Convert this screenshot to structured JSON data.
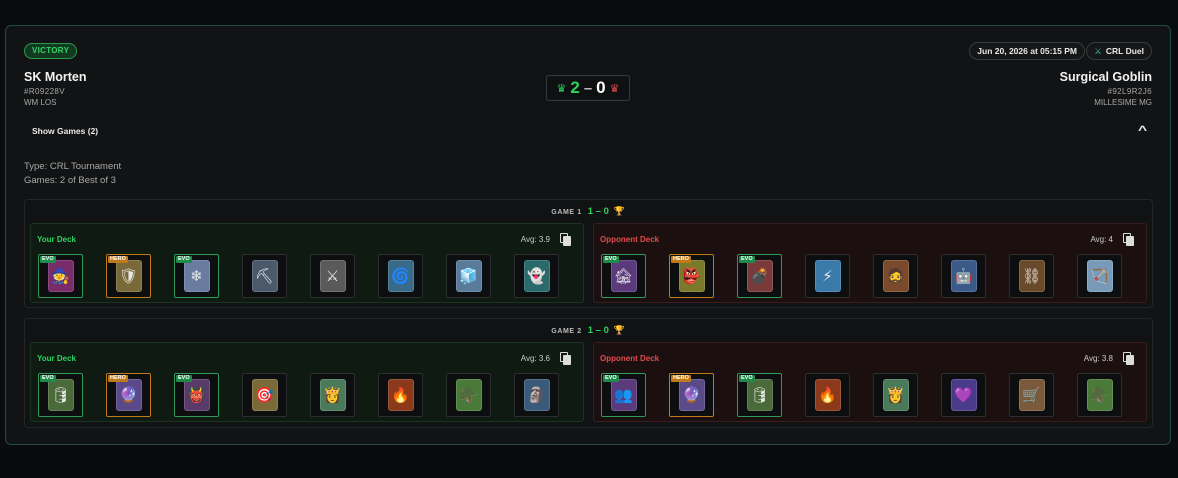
{
  "result_badge": "VICTORY",
  "date": "Jun 20, 2026 at 05:15 PM",
  "mode": {
    "icon": "crossed-swords-icon",
    "label": "CRL Duel"
  },
  "player": {
    "name": "SK Morten",
    "tag": "#R09228V",
    "clan": "WM LOS"
  },
  "opponent": {
    "name": "Surgical Goblin",
    "tag": "#92L9R2J6",
    "clan": "MILLESIME MG"
  },
  "score": {
    "player": "2",
    "separator": "–",
    "opponent": "0"
  },
  "show_games": "Show Games (2)",
  "type_line": "Type: CRL Tournament",
  "games_line": "Games: 2 of Best of 3",
  "colors": {
    "win": "#2fd35f",
    "loss": "#e24b4b",
    "accent": "#1f4a48"
  },
  "games": [
    {
      "title": "GAME 1",
      "score": "1 – 0",
      "your_deck": {
        "label": "Your Deck",
        "avg": "Avg: 3.9",
        "cards": [
          {
            "badge": "EVO",
            "icon": "witch-card",
            "glyph": "🧙",
            "color": "#7a2b6a"
          },
          {
            "badge": "HERO",
            "icon": "hero-knight-card",
            "glyph": "🛡",
            "color": "#7a6a3a"
          },
          {
            "badge": "EVO",
            "icon": "ice-spirit-card",
            "glyph": "❄",
            "color": "#6a7aa0"
          },
          {
            "badge": "",
            "icon": "miner-card",
            "glyph": "⛏",
            "color": "#4a5a6a"
          },
          {
            "badge": "",
            "icon": "mega-knight-card",
            "glyph": "⚔",
            "color": "#5a5a5a"
          },
          {
            "badge": "",
            "icon": "tornado-card",
            "glyph": "🌀",
            "color": "#3a6a8a"
          },
          {
            "badge": "",
            "icon": "ice-wizard-card",
            "glyph": "🧊",
            "color": "#5a7a9a"
          },
          {
            "badge": "",
            "icon": "spirit-card",
            "glyph": "👻",
            "color": "#2a6a6a"
          }
        ]
      },
      "opp_deck": {
        "label": "Opponent Deck",
        "avg": "Avg: 4",
        "cards": [
          {
            "badge": "EVO",
            "icon": "goblin-hut-card",
            "glyph": "🏚",
            "color": "#5a3a7a"
          },
          {
            "badge": "HERO",
            "icon": "hero-goblin-card",
            "glyph": "👺",
            "color": "#7a7a2a"
          },
          {
            "badge": "EVO",
            "icon": "bomb-tower-card",
            "glyph": "💣",
            "color": "#7a3a3a"
          },
          {
            "badge": "",
            "icon": "zap-card",
            "glyph": "⚡",
            "color": "#3a7aaa"
          },
          {
            "badge": "",
            "icon": "giant-card",
            "glyph": "🧔",
            "color": "#7a4a2a"
          },
          {
            "badge": "",
            "icon": "electro-giant-card",
            "glyph": "🤖",
            "color": "#3a5a8a"
          },
          {
            "badge": "",
            "icon": "goblin-drill-card",
            "glyph": "⛓",
            "color": "#6a4a2a"
          },
          {
            "badge": "",
            "icon": "arrows-card",
            "glyph": "🏹",
            "color": "#7a9aba"
          }
        ]
      }
    },
    {
      "title": "GAME 2",
      "score": "1 – 0",
      "your_deck": {
        "label": "Your Deck",
        "avg": "Avg: 3.6",
        "cards": [
          {
            "badge": "EVO",
            "icon": "goblin-barrel-card",
            "glyph": "🛢",
            "color": "#4a6a3a"
          },
          {
            "badge": "HERO",
            "icon": "hero-wizard-card",
            "glyph": "🔮",
            "color": "#5a4a8a"
          },
          {
            "badge": "EVO",
            "icon": "goblin-giant-card",
            "glyph": "👹",
            "color": "#5a3a6a"
          },
          {
            "badge": "",
            "icon": "cannon-card",
            "glyph": "🎯",
            "color": "#7a6a3a"
          },
          {
            "badge": "",
            "icon": "princess-card",
            "glyph": "👸",
            "color": "#4a7a5a"
          },
          {
            "badge": "",
            "icon": "fireball-card",
            "glyph": "🔥",
            "color": "#8a3a1a"
          },
          {
            "badge": "",
            "icon": "goblins-card",
            "glyph": "🪖",
            "color": "#4a7a3a"
          },
          {
            "badge": "",
            "icon": "ice-golem-card",
            "glyph": "🗿",
            "color": "#3a5a7a"
          }
        ]
      },
      "opp_deck": {
        "label": "Opponent Deck",
        "avg": "Avg: 3.8",
        "cards": [
          {
            "badge": "EVO",
            "icon": "goblin-gang-card",
            "glyph": "👥",
            "color": "#5a3a7a"
          },
          {
            "badge": "HERO",
            "icon": "hero-wizard-card",
            "glyph": "🔮",
            "color": "#5a4a8a"
          },
          {
            "badge": "EVO",
            "icon": "goblin-barrel-card",
            "glyph": "🛢",
            "color": "#4a6a3a"
          },
          {
            "badge": "",
            "icon": "fireball-card",
            "glyph": "🔥",
            "color": "#8a3a1a"
          },
          {
            "badge": "",
            "icon": "princess-card",
            "glyph": "👸",
            "color": "#4a7a5a"
          },
          {
            "badge": "",
            "icon": "electro-spirit-card",
            "glyph": "💜",
            "color": "#4a3a8a"
          },
          {
            "badge": "",
            "icon": "cannon-cart-card",
            "glyph": "🛒",
            "color": "#7a5a3a"
          },
          {
            "badge": "",
            "icon": "goblins-card",
            "glyph": "🪖",
            "color": "#4a7a3a"
          }
        ]
      }
    }
  ]
}
